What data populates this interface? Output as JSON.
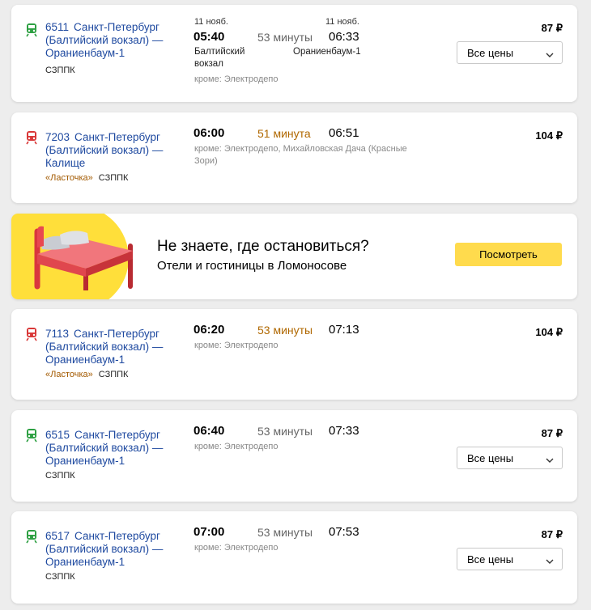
{
  "currency": "₽",
  "colors": {
    "train_green": "#2ea043",
    "train_red": "#d93838",
    "link": "#1f4aa0",
    "accent_orange": "#b06800",
    "promo_yellow": "#ffdb4d"
  },
  "trips": [
    {
      "number": "6511",
      "route": "Санкт-Петербург (Балтийский вокзал) — Ораниенбаум-1",
      "named_train": "",
      "carrier": "СЗППК",
      "icon": "train-icon-green",
      "dep_date": "11 нояб.",
      "arr_date": "11 нояб.",
      "dep_time": "05:40",
      "duration": "53 минуты",
      "duration_highlight": false,
      "arr_time": "06:33",
      "dep_station": "Балтийский вокзал",
      "arr_station": "Ораниенбаум-1",
      "except": "кроме: Электродепо",
      "price": "87 ₽",
      "prices_select": "Все цены"
    },
    {
      "number": "7203",
      "route": "Санкт-Петербург (Балтийский вокзал) — Калище",
      "named_train": "«Ласточка»",
      "carrier": "СЗППК",
      "icon": "train-icon-red",
      "dep_time": "06:00",
      "duration": "51 минута",
      "duration_highlight": true,
      "arr_time": "06:51",
      "except": "кроме: Электродепо, Михайловская Дача (Красные Зори)",
      "price": "104 ₽"
    },
    {
      "number": "7113",
      "route": "Санкт-Петербург (Балтийский вокзал) — Ораниенбаум-1",
      "named_train": "«Ласточка»",
      "carrier": "СЗППК",
      "icon": "train-icon-red",
      "dep_time": "06:20",
      "duration": "53 минуты",
      "duration_highlight": true,
      "arr_time": "07:13",
      "except": "кроме: Электродепо",
      "price": "104 ₽"
    },
    {
      "number": "6515",
      "route": "Санкт-Петербург (Балтийский вокзал) — Ораниенбаум-1",
      "named_train": "",
      "carrier": "СЗППК",
      "icon": "train-icon-green",
      "dep_time": "06:40",
      "duration": "53 минуты",
      "duration_highlight": false,
      "arr_time": "07:33",
      "except": "кроме: Электродепо",
      "price": "87 ₽",
      "prices_select": "Все цены"
    },
    {
      "number": "6517",
      "route": "Санкт-Петербург (Балтийский вокзал) — Ораниенбаум-1",
      "named_train": "",
      "carrier": "СЗППК",
      "icon": "train-icon-green",
      "dep_time": "07:00",
      "duration": "53 минуты",
      "duration_highlight": false,
      "arr_time": "07:53",
      "except": "кроме: Электродепо",
      "price": "87 ₽",
      "prices_select": "Все цены"
    }
  ],
  "promo": {
    "title": "Не знаете, где остановиться?",
    "subtitle": "Отели и гостиницы в Ломоносове",
    "button": "Посмотреть",
    "icon": "bed-icon"
  }
}
